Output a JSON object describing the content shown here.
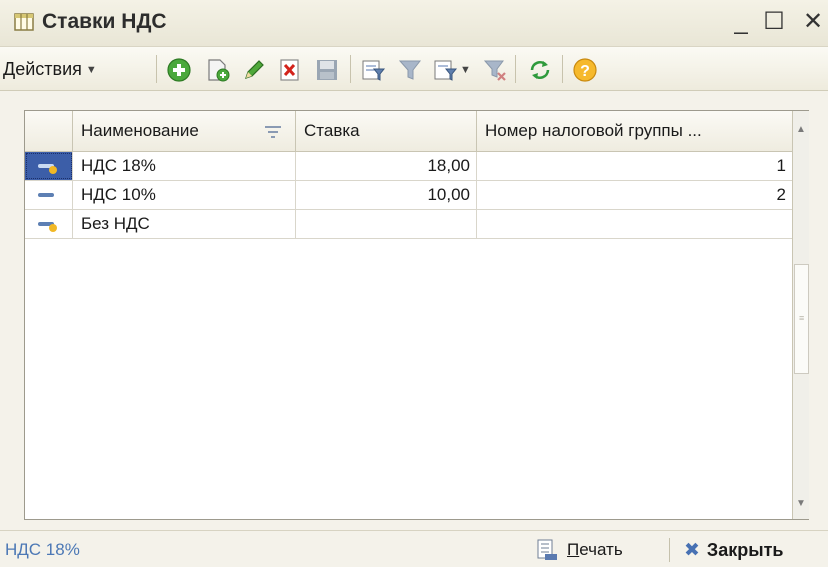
{
  "window": {
    "title": "Ставки НДС",
    "minimize_glyph": "_",
    "maximize_glyph": "☐",
    "close_glyph": "✕"
  },
  "toolbar": {
    "actions_label": "Действия",
    "icons": [
      "add-circle-icon",
      "copy-doc-icon",
      "edit-pencil-icon",
      "delete-icon",
      "save-disk-icon",
      "filter-list-icon",
      "filter-icon",
      "filter-dropdown-icon",
      "clear-filter-icon",
      "refresh-icon",
      "help-icon"
    ]
  },
  "table": {
    "columns": [
      "Наименование",
      "Ставка",
      "Номер налоговой группы ..."
    ],
    "rows": [
      {
        "name": "НДС 18%",
        "rate": "18,00",
        "group": "1",
        "selected": true
      },
      {
        "name": "НДС 10%",
        "rate": "10,00",
        "group": "2",
        "selected": false
      },
      {
        "name": "Без НДС",
        "rate": "",
        "group": "",
        "selected": false
      }
    ]
  },
  "footer": {
    "status": "НДС 18%",
    "print_label_first": "П",
    "print_label_rest": "ечать",
    "close_label": "Закрыть"
  },
  "colors": {
    "accent": "#4c78b5",
    "selection": "#3c5ea8"
  }
}
